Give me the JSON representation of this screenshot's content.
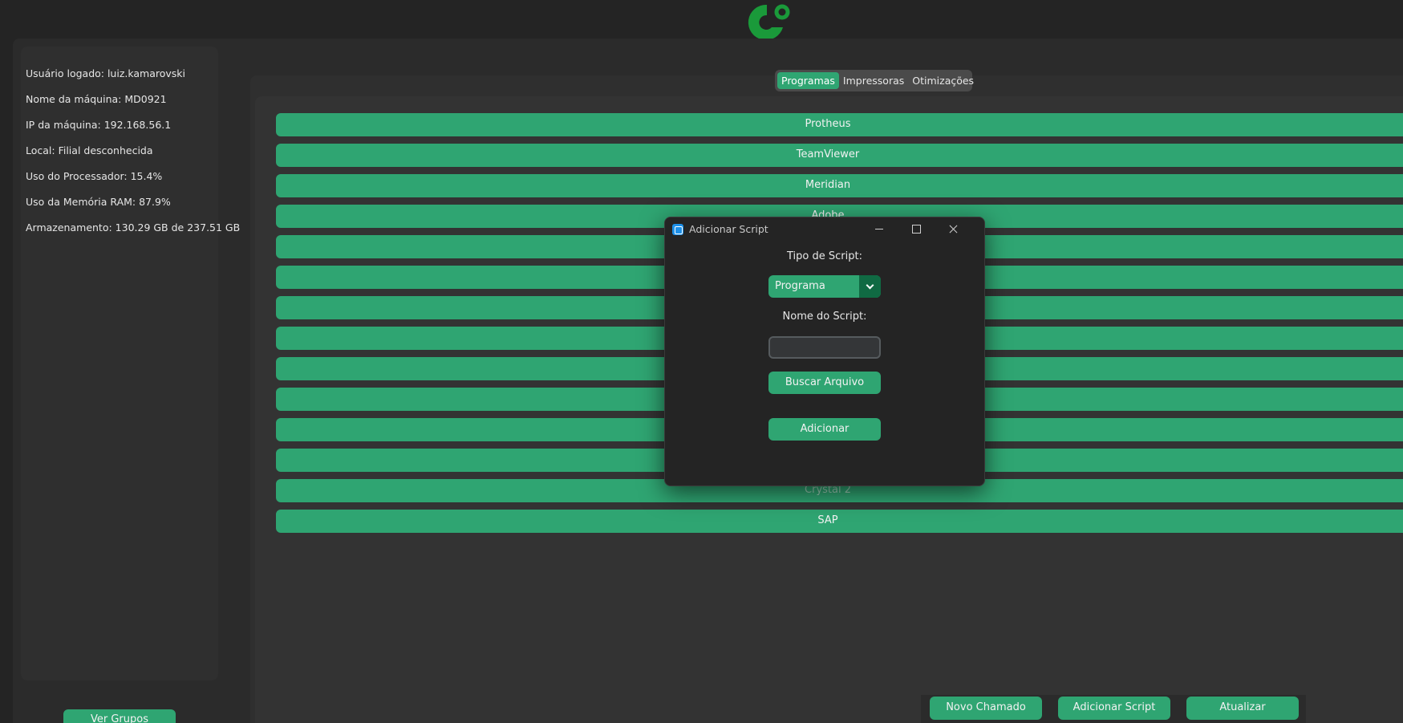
{
  "sidebar": {
    "info": [
      "Usuário logado: luiz.kamarovski",
      "Nome da máquina: MD0921",
      "IP da máquina: 192.168.56.1",
      "Local: Filial desconhecida",
      "Uso do Processador: 15.4%",
      "Uso da Memória RAM: 87.9%",
      "Armazenamento: 130.29 GB de 237.51 GB"
    ],
    "ver_grupos_label": "Ver Grupos"
  },
  "tabs": [
    {
      "label": "Programas",
      "active": true
    },
    {
      "label": "Impressoras",
      "active": false
    },
    {
      "label": "Otimizações",
      "active": false
    }
  ],
  "programs": [
    "Protheus",
    "TeamViewer",
    "Meridian",
    "Adobe",
    "",
    "",
    "",
    "",
    "",
    "",
    "",
    "",
    "Crystal 2",
    "SAP"
  ],
  "bottom_buttons": {
    "novo_chamado": "Novo Chamado",
    "adicionar_script": "Adicionar Script",
    "atualizar": "Atualizar"
  },
  "dialog": {
    "title": "Adicionar Script",
    "tipo_label": "Tipo de Script:",
    "tipo_value": "Programa",
    "nome_label": "Nome do Script:",
    "nome_value": "",
    "buscar_label": "Buscar Arquivo",
    "adicionar_label": "Adicionar"
  },
  "colors": {
    "accent": "#2fa572",
    "accent_dark": "#106a43",
    "background": "#242424",
    "logo": "#1a9a3a"
  },
  "icons": {
    "logo": "app-logo",
    "dialog": "app-window-icon",
    "minimize": "minimize-icon",
    "maximize": "maximize-icon",
    "close": "close-icon",
    "dropdown": "chevron-down-icon"
  }
}
